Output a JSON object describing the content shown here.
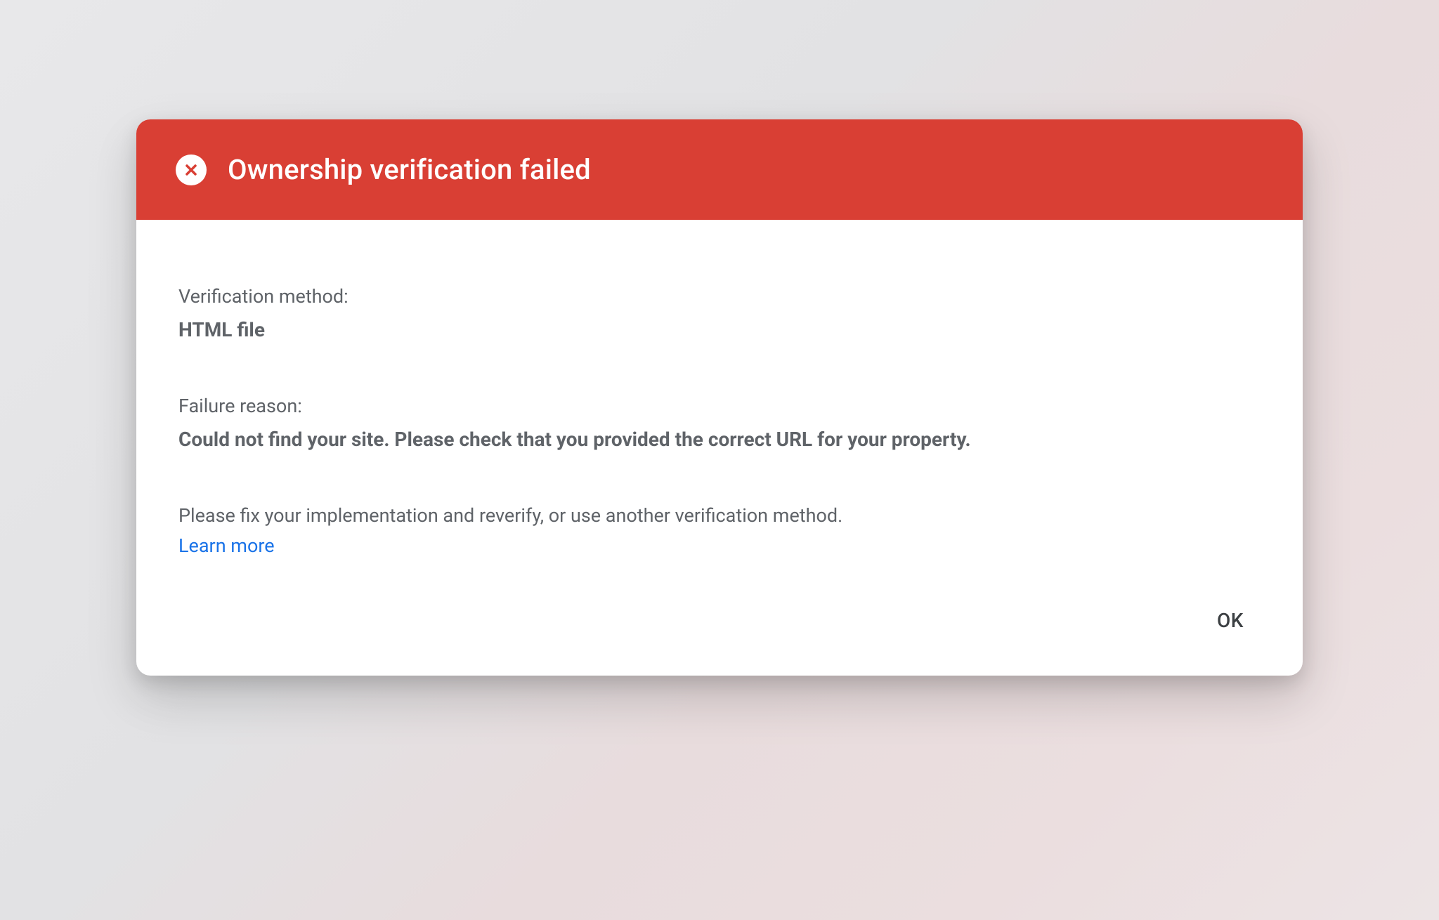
{
  "dialog": {
    "title": "Ownership verification failed",
    "sections": {
      "method": {
        "label": "Verification method:",
        "value": "HTML file"
      },
      "reason": {
        "label": "Failure reason:",
        "value": "Could not find your site. Please check that you provided the correct URL for your property."
      }
    },
    "help_text": "Please fix your implementation and reverify, or use another verification method.",
    "learn_more_label": "Learn more",
    "ok_button_label": "OK"
  },
  "colors": {
    "header_bg": "#d93f34",
    "link": "#1a73e8",
    "text_secondary": "#5f6368"
  }
}
